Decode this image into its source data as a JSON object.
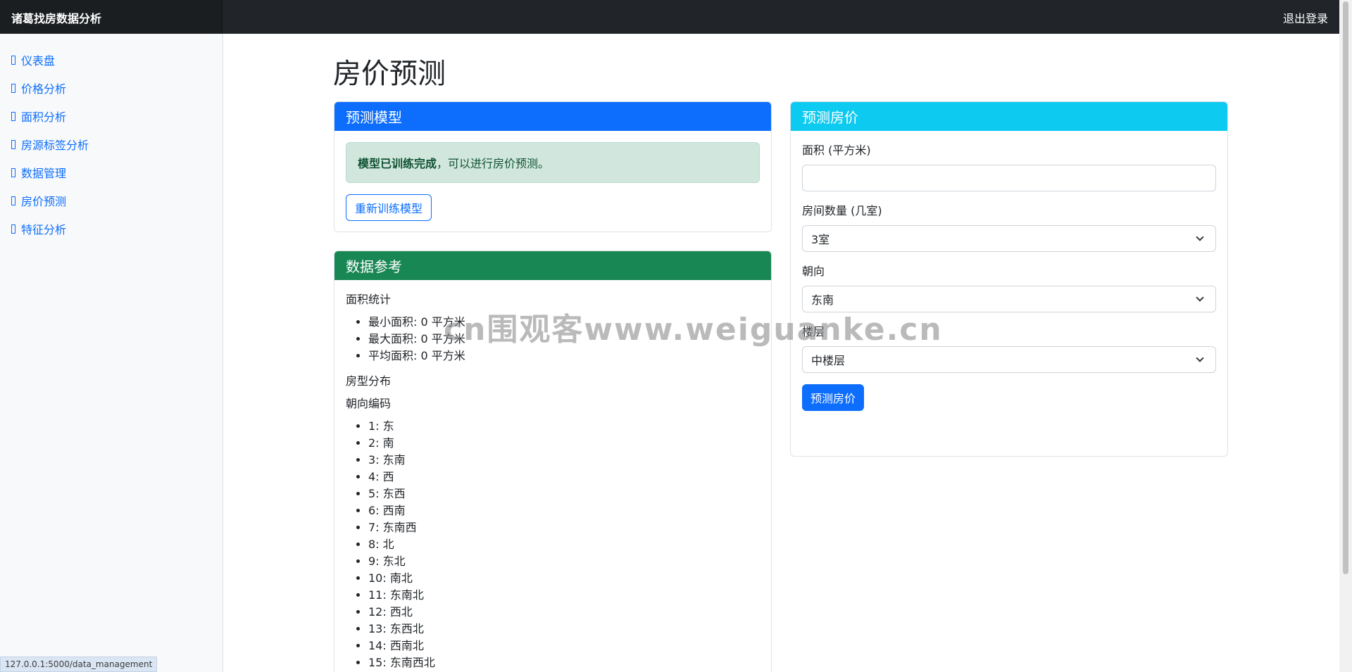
{
  "navbar": {
    "brand": "诸葛找房数据分析",
    "logout": "退出登录"
  },
  "sidebar": {
    "items": [
      {
        "label": "仪表盘"
      },
      {
        "label": "价格分析"
      },
      {
        "label": "面积分析"
      },
      {
        "label": "房源标签分析"
      },
      {
        "label": "数据管理"
      },
      {
        "label": "房价预测"
      },
      {
        "label": "特征分析"
      }
    ]
  },
  "page": {
    "title": "房价预测"
  },
  "model_card": {
    "header": "预测模型",
    "alert_strong": "模型已训练完成",
    "alert_rest": "，可以进行房价预测。",
    "retrain_button": "重新训练模型"
  },
  "reference_card": {
    "header": "数据参考",
    "area_title": "面积统计",
    "area_items": [
      "最小面积: 0 平方米",
      "最大面积: 0 平方米",
      "平均面积: 0 平方米"
    ],
    "layout_title": "房型分布",
    "orientation_title": "朝向编码",
    "orientation_items": [
      "1: 东",
      "2: 南",
      "3: 东南",
      "4: 西",
      "5: 东西",
      "6: 西南",
      "7: 东南西",
      "8: 北",
      "9: 东北",
      "10: 南北",
      "11: 东南北",
      "12: 西北",
      "13: 东西北",
      "14: 西南北",
      "15: 东南西北"
    ]
  },
  "predict_card": {
    "header": "预测房价",
    "area_label": "面积 (平方米)",
    "area_value": "",
    "rooms_label": "房间数量 (几室)",
    "rooms_value": "3室",
    "orientation_label": "朝向",
    "orientation_value": "东南",
    "floor_label": "楼层",
    "floor_value": "中楼层",
    "submit_button": "预测房价"
  },
  "statusbar": {
    "url": "127.0.0.1:5000/data_management"
  },
  "watermark": {
    "text": "cn围观客www.weiguanke.cn"
  },
  "colors": {
    "primary": "#0d6efd",
    "success": "#198754",
    "info": "#0dcaf0",
    "dark": "#212529"
  }
}
